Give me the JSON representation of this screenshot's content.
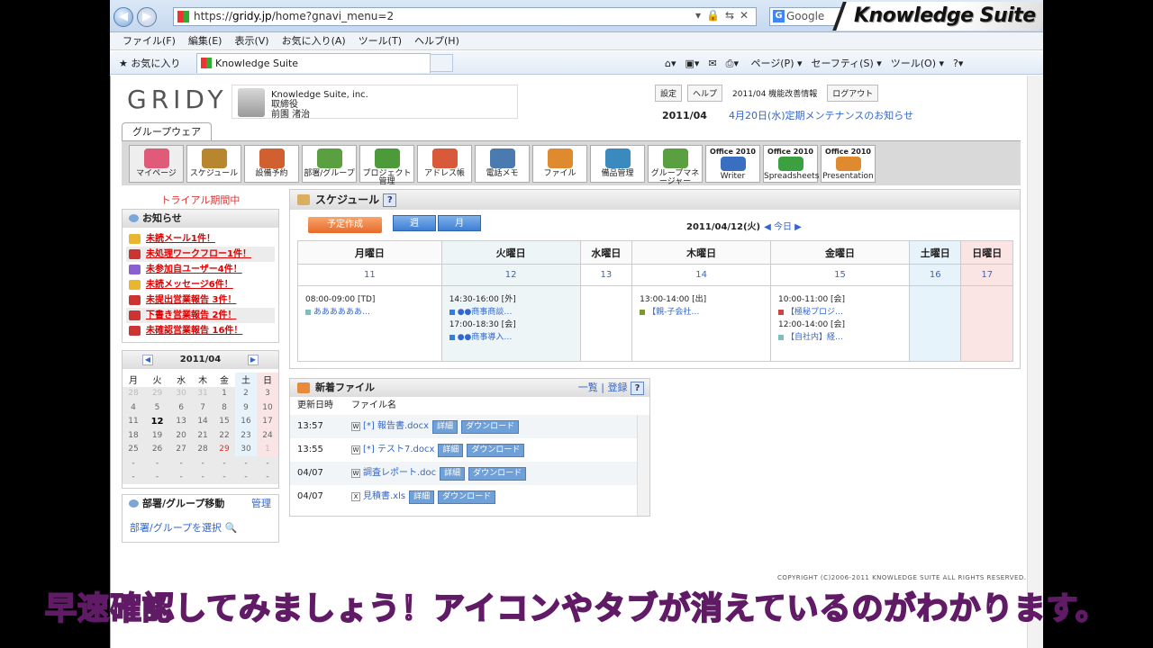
{
  "browser": {
    "url_prefix": "https://",
    "url_host": "gridy.jp",
    "url_path": "/home?gnavi_menu=2",
    "search": "Google",
    "brand": "Knowledge Suite"
  },
  "menu": [
    "ファイル(F)",
    "編集(E)",
    "表示(V)",
    "お気に入り(A)",
    "ツール(T)",
    "ヘルプ(H)"
  ],
  "favbar": {
    "favorites": "お気に入り",
    "tab": "Knowledge Suite",
    "cmds": [
      "ページ(P) ▾",
      "セーフティ(S) ▾",
      "ツール(O) ▾"
    ]
  },
  "header": {
    "logo": "GRIDY",
    "company": "Knowledge Suite, inc.",
    "role": "取締役",
    "user": "前園 渚治",
    "links": [
      "設定",
      "ヘルプ",
      "2011/04 機能改善情報",
      "ログアウト"
    ],
    "maint_date": "2011/04",
    "maint_text": "4月20日(水)定期メンテナンスのお知らせ"
  },
  "tab": "グループウェア",
  "icons": [
    {
      "label": "マイページ",
      "color": "#e05a7a"
    },
    {
      "label": "スケジュール",
      "color": "#b8862e"
    },
    {
      "label": "設備予約",
      "color": "#d06030"
    },
    {
      "label": "部署/グループ",
      "color": "#5aa040"
    },
    {
      "label": "プロジェクト管理",
      "color": "#4c9a3a"
    },
    {
      "label": "アドレス帳",
      "color": "#d85a3a"
    },
    {
      "label": "電話メモ",
      "color": "#4a7ab0"
    },
    {
      "label": "ファイル",
      "color": "#e08a30"
    },
    {
      "label": "備品管理",
      "color": "#3a8ac0"
    },
    {
      "label": "グループマネージャー",
      "color": "#5aa040"
    },
    {
      "label": "Writer",
      "off": "Office 2010",
      "color": "#3a6ec0"
    },
    {
      "label": "Spreadsheets",
      "off": "Office 2010",
      "color": "#3aa040"
    },
    {
      "label": "Presentation",
      "off": "Office 2010",
      "color": "#e08a30"
    }
  ],
  "trial": "トライアル期間中",
  "notice": {
    "title": "お知らせ",
    "items": [
      "未読メール1件！",
      "未処理ワークフロー1件！",
      "未参加自ユーザー4件！",
      "未読メッセージ6件！",
      "未提出営業報告 3件！",
      "下書き営業報告 2件！",
      "未確認営業報告 16件！"
    ]
  },
  "minical": {
    "title": "2011/04",
    "weekdays": [
      "月",
      "火",
      "水",
      "木",
      "金",
      "土",
      "日"
    ],
    "weeks": [
      [
        "28",
        "29",
        "30",
        "31",
        "1",
        "2",
        "3"
      ],
      [
        "4",
        "5",
        "6",
        "7",
        "8",
        "9",
        "10"
      ],
      [
        "11",
        "12",
        "13",
        "14",
        "15",
        "16",
        "17"
      ],
      [
        "18",
        "19",
        "20",
        "21",
        "22",
        "23",
        "24"
      ],
      [
        "25",
        "26",
        "27",
        "28",
        "29",
        "30",
        "1"
      ],
      [
        "-",
        "-",
        "-",
        "-",
        "-",
        "-",
        "-"
      ],
      [
        "-",
        "-",
        "-",
        "-",
        "-",
        "-",
        "-"
      ]
    ]
  },
  "dept": {
    "title": "部署/グループ移動",
    "manage": "管理",
    "select": "部署/グループを選択"
  },
  "schedule": {
    "title": "スケジュール",
    "help": "?",
    "new_btn": "予定作成",
    "week": "週",
    "month": "月",
    "date": "2011/04/12(火)",
    "today": "◀ 今日 ▶",
    "days": [
      "月曜日",
      "火曜日",
      "水曜日",
      "木曜日",
      "金曜日",
      "土曜日",
      "日曜日"
    ],
    "nums": [
      "11",
      "12",
      "13",
      "14",
      "15",
      "16",
      "17"
    ],
    "events": {
      "mon": [
        [
          "08:00-09:00 [TD]",
          "ああああああ…"
        ]
      ],
      "tue": [
        [
          "14:30-16:00 [外]",
          "●●商事商談…"
        ],
        [
          "17:00-18:30 [会]",
          "●●商事導入…"
        ]
      ],
      "thu": [
        [
          "13:00-14:00 [出]",
          "【親-子会社…"
        ]
      ],
      "fri": [
        [
          "10:00-11:00 [会]",
          "【極秘プロジ…"
        ],
        [
          "12:00-14:00 [会]",
          "【自社内】経…"
        ]
      ]
    }
  },
  "files": {
    "title": "新着ファイル",
    "links": "一覧 | 登録",
    "col_time": "更新日時",
    "col_name": "ファイル名",
    "detail": "詳細",
    "download": "ダウンロード",
    "rows": [
      [
        "13:57",
        "W",
        "[*] 報告書.docx"
      ],
      [
        "13:55",
        "W",
        "[*] テスト7.docx"
      ],
      [
        "04/07",
        "W",
        "調査レポート.doc"
      ],
      [
        "04/07",
        "X",
        "見積書.xls"
      ]
    ]
  },
  "copyright": "COPYRIGHT (C)2006-2011 KNOWLEDGE SUITE ALL RIGHTS RESERVED.",
  "subtitle": "早速確認してみましょう！アイコンやタブが消えているのがわかります。"
}
